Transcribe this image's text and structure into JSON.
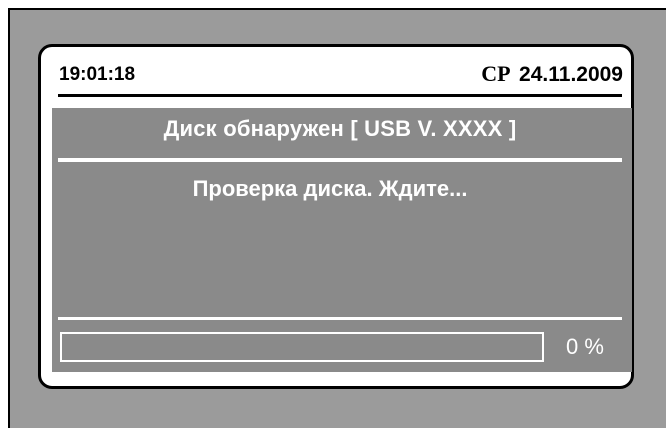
{
  "header": {
    "time": "19:01:18",
    "weekday": "СР",
    "date": "24.11.2009"
  },
  "dialog": {
    "title": "Диск обнаружен [ USB V. XXXX ]",
    "message": "Проверка диска. Ждите..."
  },
  "progress": {
    "fraction": 0,
    "label": "0 %"
  },
  "colors": {
    "panel": "#8a8a8a",
    "frame": "#9b9b9b",
    "text_on_panel": "#ffffff",
    "header_text": "#000000"
  }
}
